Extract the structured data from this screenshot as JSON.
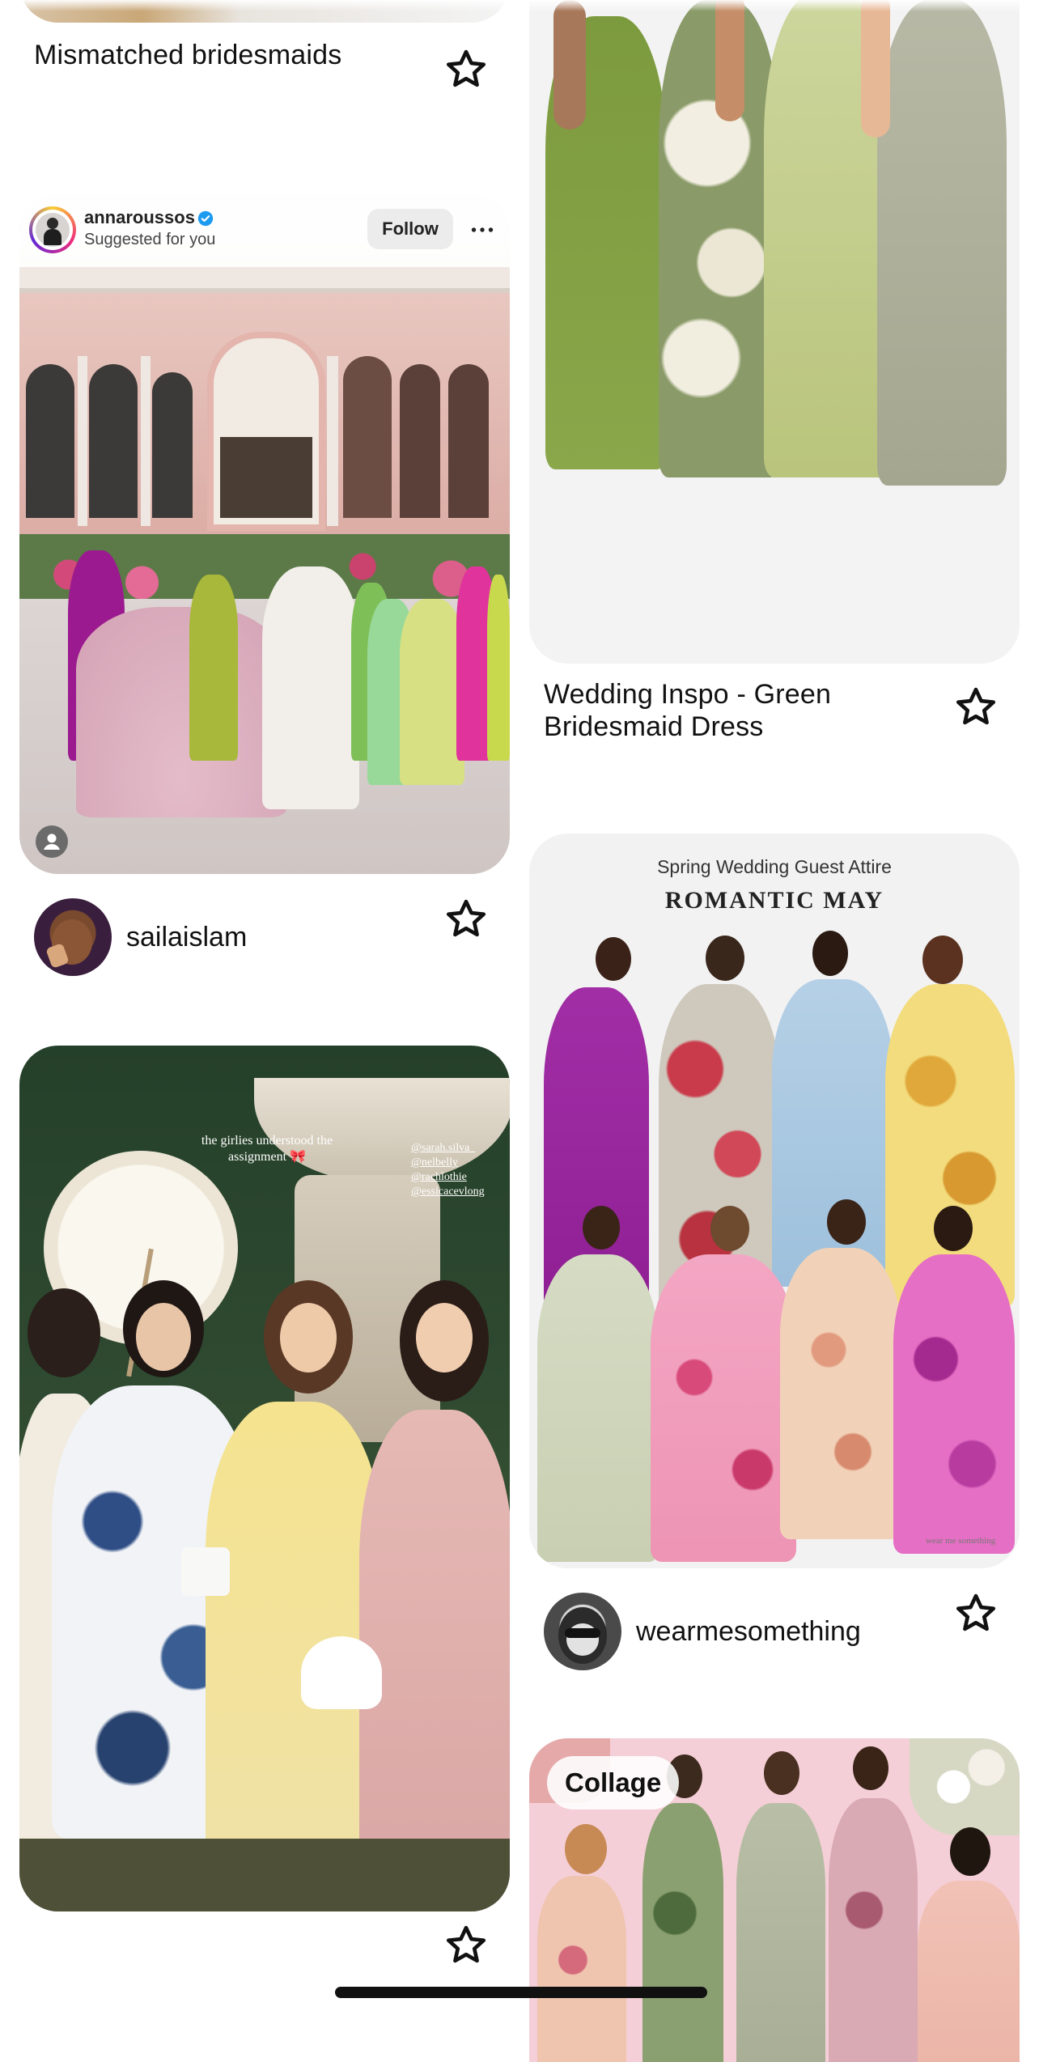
{
  "pins": {
    "pin1": {
      "title": "Mismatched bridesmaids"
    },
    "pin2": {
      "creator": "annaroussos",
      "subtitle": "Suggested for you",
      "follow_label": "Follow",
      "more_label": "⋯",
      "saver": "sailaislam"
    },
    "pin3": {
      "caption": "the girlies understood the assignment 🎀",
      "tags": [
        "@sarah.silva_",
        "@nelbelly",
        "@rachlothie",
        "@essicacevlong"
      ]
    },
    "pin4": {
      "title_line1": "Wedding Inspo - Green",
      "title_line2": "Bridesmaid Dress"
    },
    "pin5": {
      "header_line1": "Spring Wedding Guest Attire",
      "header_line2": "ROMANTIC MAY",
      "watermark": "wear me something",
      "saver": "wearmesomething"
    },
    "pin6": {
      "badge": "Collage"
    }
  },
  "colors": {
    "star_stroke": "#111111",
    "home_indicator": "#111111",
    "follow_bg": "#efefef",
    "verified": "#1d9bf0"
  }
}
